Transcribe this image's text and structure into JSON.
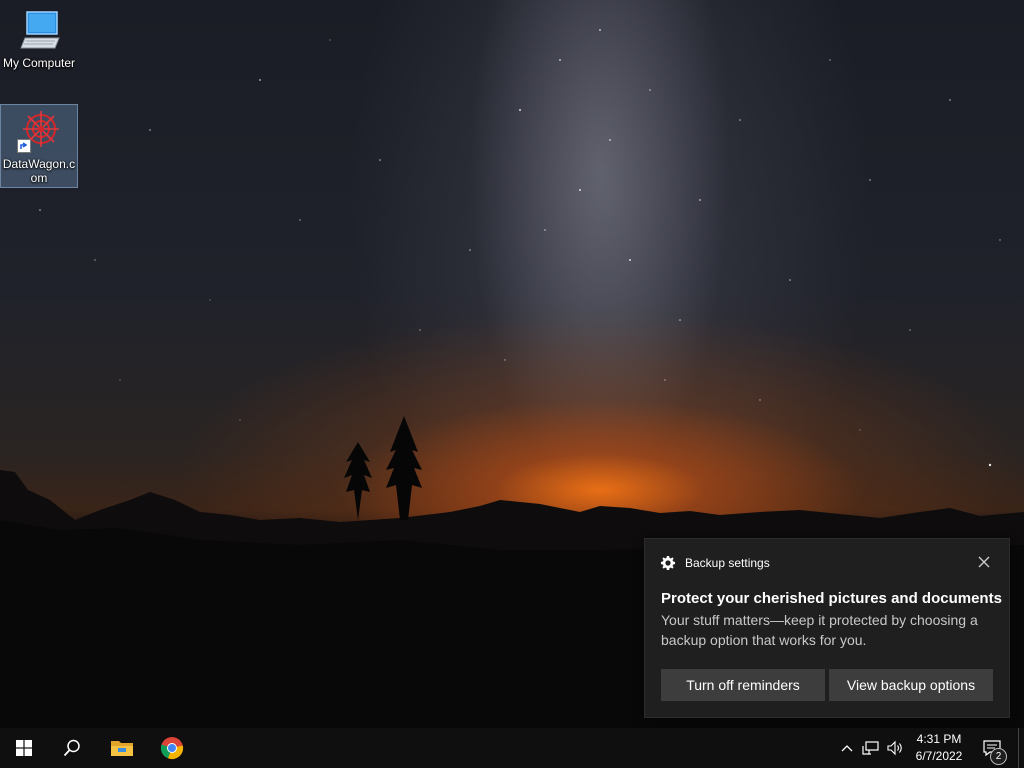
{
  "desktop": {
    "icons": [
      {
        "label": "My Computer",
        "icon": "computer-icon"
      },
      {
        "label": "DataWagon.c\nom",
        "icon": "datawagon-icon",
        "selected": true
      }
    ]
  },
  "toast": {
    "app_name": "Backup settings",
    "title": "Protect your cherished pictures and documents",
    "body": "Your stuff matters—keep it protected by choosing a backup option that works for you.",
    "buttons": {
      "turn_off": "Turn off reminders",
      "view_options": "View backup options"
    },
    "icons": {
      "app": "gear-icon",
      "close": "close-icon"
    }
  },
  "taskbar": {
    "items": [
      "windows-start-icon",
      "search-icon",
      "file-explorer-icon",
      "chrome-icon"
    ],
    "tray": [
      "chevron-up-icon",
      "network-icon",
      "volume-icon"
    ],
    "clock": {
      "time": "4:31 PM",
      "date": "6/7/2022"
    },
    "notification_count": "2"
  },
  "colors": {
    "toast_bg": "#1f1f1f",
    "button_bg": "#3d3d3d",
    "taskbar_bg": "#0f0f0f"
  }
}
